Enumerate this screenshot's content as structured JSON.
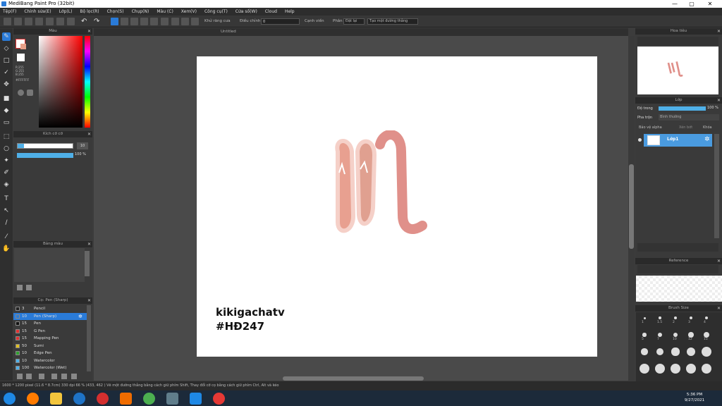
{
  "window": {
    "title": "MediBang Paint Pro (32bit)",
    "controls": [
      "—",
      "▢",
      "✕"
    ]
  },
  "menu": [
    "Tệp(F)",
    "Chỉnh sửa(E)",
    "Lớp(L)",
    "Bộ lọc(R)",
    "Chọn(S)",
    "Chụp(N)",
    "Màu (C)",
    "Xem(V)",
    "Công cụ(T)",
    "Cửa sổ(W)",
    "Cloud",
    "Help"
  ],
  "toolbar": {
    "antialias_label": "Khử răng cưa",
    "adjust_label": "Điều chỉnh",
    "adjust_value": "0",
    "edge_label": "Cạnh viền",
    "snap_label": "Phân",
    "snap_off_label": "Đặt lại",
    "create_line_label": "Tạo một đường thẳng"
  },
  "document": {
    "tab_title": "Untitled",
    "watermark_line1": "kikigachatv",
    "watermark_line2": "#HĐ247"
  },
  "color_panel": {
    "title": "Màu",
    "r": "R:255",
    "g": "G:255",
    "b": "B:255",
    "hex": "#FFFFFF"
  },
  "size_panel": {
    "title": "Kích cỡ cỡ",
    "size_value": "10",
    "opacity_value": "100 %"
  },
  "palette_panel": {
    "title": "Bảng màu"
  },
  "brush_panel": {
    "title": "Cọ: Pen (Sharp)",
    "items": [
      {
        "size": "3",
        "name": "Pencil",
        "color": "#222222",
        "selected": false
      },
      {
        "size": "10",
        "name": "Pen (Sharp)",
        "color": "#2a7bd8",
        "selected": true
      },
      {
        "size": "15",
        "name": "Pen",
        "color": "#111111",
        "selected": false
      },
      {
        "size": "15",
        "name": "G Pen",
        "color": "#e03030",
        "selected": false
      },
      {
        "size": "15",
        "name": "Mapping Pen",
        "color": "#e03030",
        "selected": false
      },
      {
        "size": "50",
        "name": "Sumi",
        "color": "#e0c020",
        "selected": false
      },
      {
        "size": "10",
        "name": "Edge Pen",
        "color": "#30a030",
        "selected": false
      },
      {
        "size": "10",
        "name": "Watercolor",
        "color": "#4fb0e8",
        "selected": false
      },
      {
        "size": "100",
        "name": "Watercolor (Wet)",
        "color": "#4fb0e8",
        "selected": false
      }
    ]
  },
  "navigator_panel": {
    "title": "Hoa tiêu"
  },
  "layer_panel": {
    "title": "Lớp",
    "opacity_label": "Độ trong",
    "opacity_value": "100 %",
    "blend_label": "Pha trộn",
    "blend_value": "Bình thường",
    "protect_alpha_label": "Bảo vệ alpha",
    "clipping_label": "Xén bớt",
    "lock_label": "Khóa",
    "layers": [
      {
        "name": "Lớp1",
        "selected": true
      }
    ]
  },
  "reference_panel": {
    "title": "Reference"
  },
  "brush_size_panel": {
    "title": "Brush Size",
    "sizes": [
      "1",
      "1.5",
      "2",
      "3",
      "4",
      "5",
      "7",
      "10",
      "12",
      "15",
      "20",
      "25",
      "30",
      "40",
      "50",
      "70",
      "100",
      "150",
      "200",
      "300"
    ]
  },
  "status": {
    "text": "1600 * 1200 pixel  (11.6 * 8.7cm)  330 dpi  66 %  (433, 462 )  Vẽ một đường thẳng bằng cách giữ phím Shift, Thay đổi cỡ cọ bằng cách giữ phím Ctrl, Alt và kéo"
  },
  "taskbar": {
    "time": "5:36 PM",
    "date": "9/27/2021"
  }
}
